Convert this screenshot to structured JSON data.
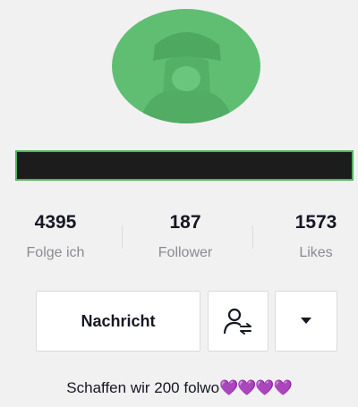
{
  "profile": {
    "stats": [
      {
        "value": "4395",
        "label": "Folge ich"
      },
      {
        "value": "187",
        "label": "Follower"
      },
      {
        "value": "1573",
        "label": "Likes"
      }
    ],
    "message_button": "Nachricht",
    "bio_text": "Schaffen wir 200 folwo",
    "bio_emojis": "💜💜💜💜"
  },
  "icons": {
    "follow_friends": "person-swap-icon",
    "dropdown": "caret-down-icon"
  },
  "colors": {
    "avatar": "#5fbe72",
    "name_border": "#4fb45e",
    "heart": "#8e3bd9"
  }
}
